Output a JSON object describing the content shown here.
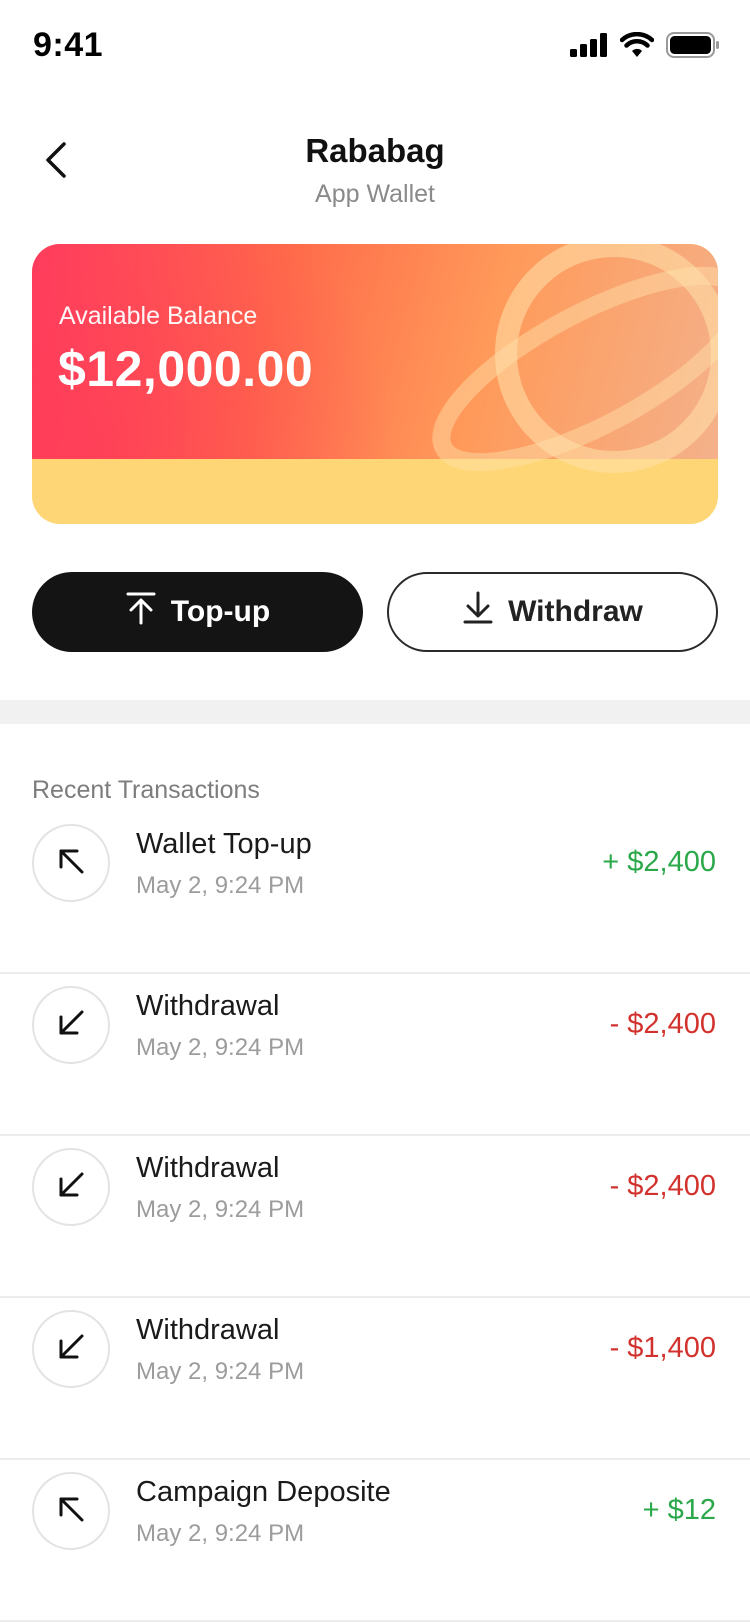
{
  "status_bar": {
    "time": "9:41",
    "icons": [
      "signal-icon",
      "wifi-icon",
      "battery-icon"
    ]
  },
  "header": {
    "back_icon": "chevron-left-icon",
    "title": "Rababag",
    "subtitle": "App Wallet"
  },
  "balance_card": {
    "label": "Available Balance",
    "amount": "$12,000.00",
    "decoration_icon": "planet-icon",
    "colors": {
      "gradient_start": "#FF3D5E",
      "gradient_end": "#F4B18A",
      "footer": "#FFD675"
    }
  },
  "actions": {
    "topup": {
      "label": "Top-up",
      "icon": "upload-icon"
    },
    "withdraw": {
      "label": "Withdraw",
      "icon": "download-icon"
    }
  },
  "transactions": {
    "title": "Recent Transactions",
    "items": [
      {
        "title": "Wallet Top-up",
        "date": "May 2, 9:24 PM",
        "amount": "+ $2,400",
        "type": "credit",
        "icon": "arrow-up-left-icon"
      },
      {
        "title": "Withdrawal",
        "date": "May 2, 9:24 PM",
        "amount": "- $2,400",
        "type": "debit",
        "icon": "arrow-down-left-icon"
      },
      {
        "title": "Withdrawal",
        "date": "May 2, 9:24 PM",
        "amount": "- $2,400",
        "type": "debit",
        "icon": "arrow-down-left-icon"
      },
      {
        "title": "Withdrawal",
        "date": "May 2, 9:24 PM",
        "amount": "- $1,400",
        "type": "debit",
        "icon": "arrow-down-left-icon"
      },
      {
        "title": "Campaign Deposite",
        "date": "May 2, 9:24 PM",
        "amount": "+ $12",
        "type": "credit",
        "icon": "arrow-up-left-icon"
      }
    ]
  },
  "colors": {
    "credit": "#2BA84A",
    "debit": "#D2322D",
    "primary_button": "#141414"
  }
}
